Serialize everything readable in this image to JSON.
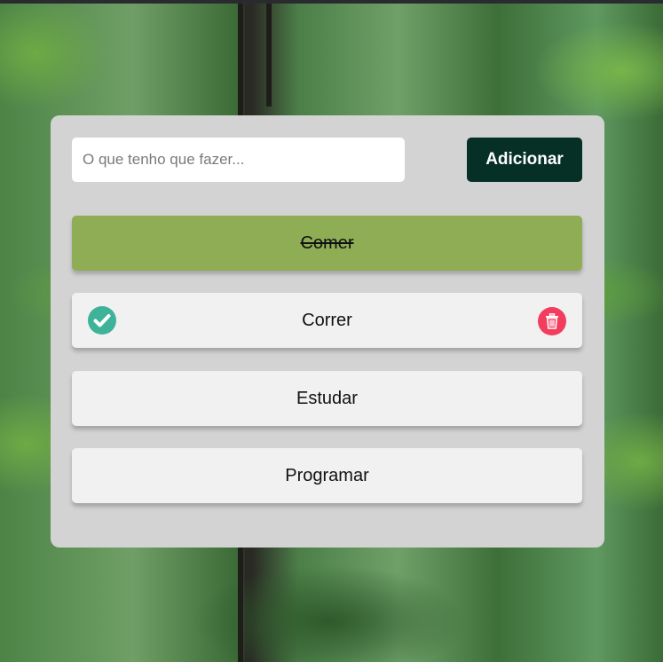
{
  "new_task": {
    "placeholder": "O que tenho que fazer...",
    "value": ""
  },
  "add_button": {
    "label": "Adicionar"
  },
  "tasks": [
    {
      "label": "Comer",
      "completed": true
    },
    {
      "label": "Correr",
      "completed": false,
      "hovered": true
    },
    {
      "label": "Estudar",
      "completed": false
    },
    {
      "label": "Programar",
      "completed": false
    }
  ],
  "icons": {
    "check": "check-circle-icon",
    "delete": "trash-icon"
  },
  "colors": {
    "card_background": "#d3d3d3",
    "add_button": "#063026",
    "completed_task": "#8fad55",
    "task": "#f1f1f1",
    "check_icon": "#3fb39a",
    "delete_icon": "#f23d5f"
  }
}
